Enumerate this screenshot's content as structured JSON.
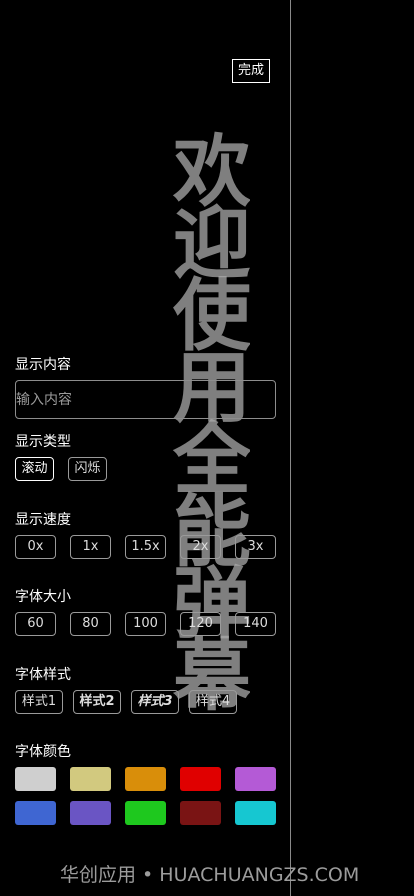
{
  "done_label": "完成",
  "marquee_text": "欢迎使用全能弹幕",
  "content": {
    "label": "显示内容",
    "placeholder": "输入内容"
  },
  "display_type": {
    "label": "显示类型",
    "options": [
      "滚动",
      "闪烁"
    ],
    "selected": "滚动"
  },
  "speed": {
    "label": "显示速度",
    "options": [
      "0x",
      "1x",
      "1.5x",
      "2x",
      "3x"
    ]
  },
  "font_size": {
    "label": "字体大小",
    "options": [
      "60",
      "80",
      "100",
      "120",
      "140"
    ]
  },
  "font_style": {
    "label": "字体样式",
    "options": [
      "样式1",
      "样式2",
      "样式3",
      "样式4"
    ]
  },
  "font_color": {
    "label": "字体颜色",
    "colors": [
      "#cfcfcf",
      "#d2c97f",
      "#d98e0a",
      "#e00000",
      "#b45ad6",
      "#3f66d2",
      "#6a55c4",
      "#1ec81e",
      "#7a1414",
      "#16c7d1"
    ]
  },
  "watermark": "华创应用 • HUACHUANGZS.COM"
}
